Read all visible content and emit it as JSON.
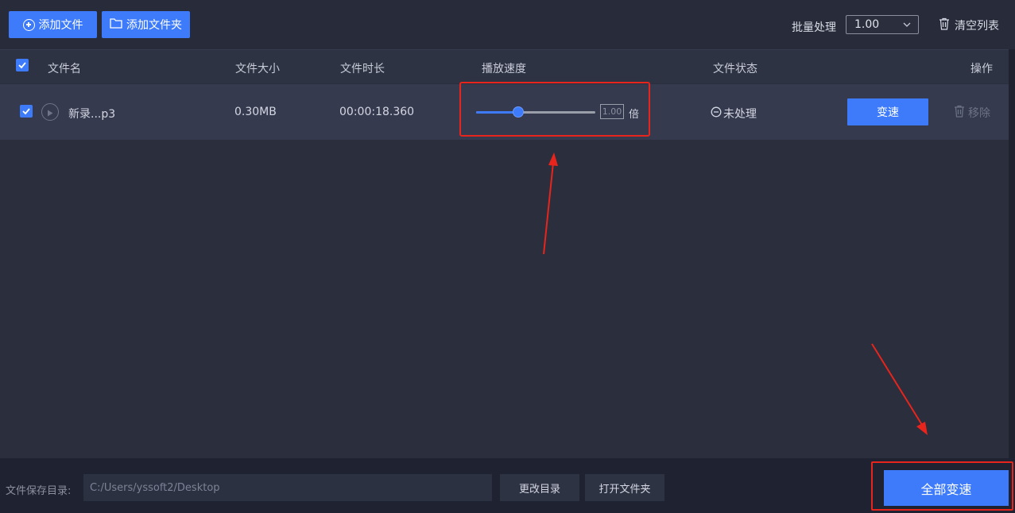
{
  "toolbar": {
    "add_file_label": "添加文件",
    "add_folder_label": "添加文件夹",
    "batch_label": "批量处理",
    "batch_value": "1.00",
    "clear_list_label": "清空列表"
  },
  "table": {
    "headers": {
      "name": "文件名",
      "size": "文件大小",
      "duration": "文件时长",
      "speed": "播放速度",
      "status": "文件状态",
      "action": "操作"
    },
    "rows": [
      {
        "checked": true,
        "name": "新录...p3",
        "size": "0.30MB",
        "duration": "00:00:18.360",
        "speed_value": "1.00",
        "speed_unit": "倍",
        "speed_slider_fraction": 0.35,
        "status": "未处理",
        "speed_button_label": "变速",
        "remove_label": "移除"
      }
    ]
  },
  "footer": {
    "save_dir_label": "文件保存目录:",
    "save_dir_path": "C:/Users/yssoft2/Desktop",
    "change_dir_label": "更改目录",
    "open_folder_label": "打开文件夹",
    "all_speed_label": "全部变速"
  },
  "colors": {
    "accent": "#3d7bfa",
    "annotation": "#e8251c",
    "background": "#2a2e3d"
  }
}
